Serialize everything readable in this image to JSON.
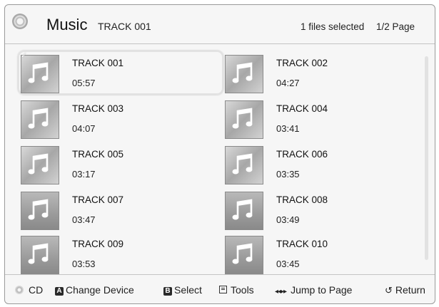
{
  "header": {
    "title": "Music",
    "subtitle": "TRACK 001",
    "files_selected": "1 files selected",
    "page": "1/2 Page",
    "icon": "disc-icon"
  },
  "tracks": [
    {
      "name": "TRACK 001",
      "duration": "05:57",
      "selected": true
    },
    {
      "name": "TRACK 002",
      "duration": "04:27"
    },
    {
      "name": "TRACK 003",
      "duration": "04:07"
    },
    {
      "name": "TRACK 004",
      "duration": "03:41"
    },
    {
      "name": "TRACK 005",
      "duration": "03:17"
    },
    {
      "name": "TRACK 006",
      "duration": "03:35"
    },
    {
      "name": "TRACK 007",
      "duration": "03:47"
    },
    {
      "name": "TRACK 008",
      "duration": "03:49"
    },
    {
      "name": "TRACK 009",
      "duration": "03:53"
    },
    {
      "name": "TRACK 010",
      "duration": "03:45"
    }
  ],
  "footer": {
    "cd": "CD",
    "change_device_key": "A",
    "change_device": "Change Device",
    "select_key": "B",
    "select": "Select",
    "tools": "Tools",
    "jump_glyph": "◂◂▸▸",
    "jump": "Jump to Page",
    "return_glyph": "↺",
    "return": "Return"
  }
}
